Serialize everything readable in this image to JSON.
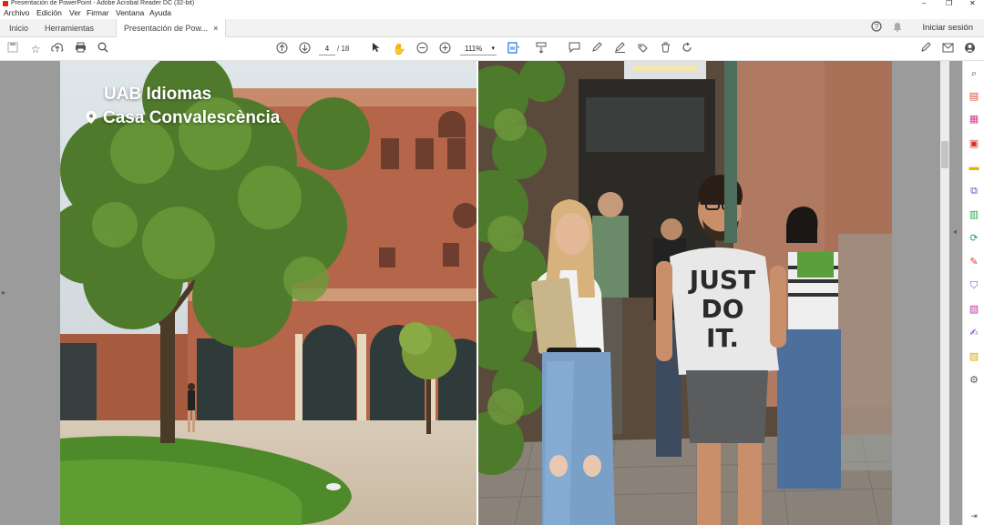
{
  "window": {
    "title": "Presentación de PowerPoint - Adobe Acrobat Reader DC (32-bit)",
    "minimize_glyph": "–",
    "maximize_glyph": "❐",
    "close_glyph": "✕"
  },
  "menu": [
    "Archivo",
    "Edición",
    "Ver",
    "Firmar",
    "Ventana",
    "Ayuda"
  ],
  "tabs": {
    "home": "Inicio",
    "tools": "Herramientas",
    "document": "Presentación de Pow...",
    "close_glyph": "×"
  },
  "header": {
    "signin": "Iniciar sesión"
  },
  "toolbar": {
    "page_current": "4",
    "page_total": "/ 18",
    "zoom": "111%",
    "zoom_dropdown": "▾"
  },
  "document": {
    "heading": "UAB Idiomas",
    "location": "Casa Convalescència",
    "shirt_line1": "JUST",
    "shirt_line2": "DO",
    "shirt_line3": "IT."
  },
  "colors": {
    "accent_blue": "#1a73e8",
    "toolbar_gray": "#9b9b9b",
    "brick": "#b5654a",
    "grass": "#4f8a2a"
  },
  "icons": {
    "save": "save-icon",
    "bookmark": "star-icon",
    "upload": "cloud-upload-icon",
    "print": "printer-icon",
    "search": "search-icon",
    "prev": "arrow-up-icon",
    "next": "arrow-down-icon",
    "select": "cursor-icon",
    "hand": "hand-icon",
    "zoom_out": "zoom-out-icon",
    "zoom_in": "zoom-in-icon",
    "fit": "fit-page-icon",
    "scroll": "scroll-mode-icon",
    "comment": "comment-icon",
    "highlight": "pen-icon",
    "sign": "signature-icon",
    "stamp": "stamp-icon",
    "delete": "trash-icon",
    "rotate": "rotate-icon",
    "help": "help-icon",
    "bell": "bell-icon"
  }
}
